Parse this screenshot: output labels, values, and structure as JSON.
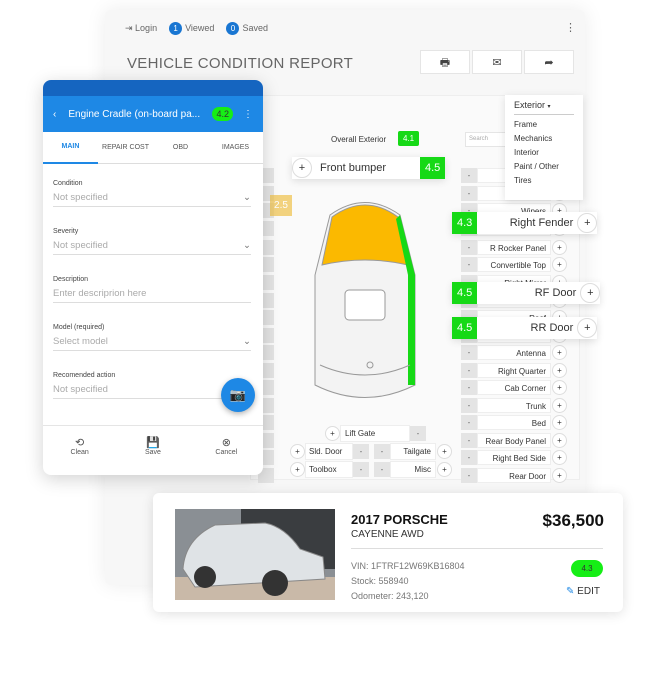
{
  "header": {
    "login": "Login",
    "viewed_count": "1",
    "viewed": "Viewed",
    "saved_count": "0",
    "saved": "Saved"
  },
  "title": "VEHICLE CONDITION REPORT",
  "toolbar": {
    "print": "🖶",
    "mail": "✉",
    "share": "➦"
  },
  "overall": {
    "label": "Overall Exterior",
    "score": "4.1"
  },
  "search_placeholder": "Search",
  "dropdown": {
    "selected": "Exterior",
    "options": [
      "Frame",
      "Mechanics",
      "Interior",
      "Paint / Other",
      "Tires"
    ]
  },
  "right_parts": [
    "",
    "Marker",
    "Wipers",
    "Right Fender",
    "R Rocker Panel",
    "Convertible Top",
    "Right Mirror",
    "RF Door",
    "Roof",
    "RR Door",
    "Antenna",
    "Right Quarter",
    "Cab Corner",
    "Trunk",
    "Bed",
    "Rear Body Panel",
    "Right Bed Side",
    "Rear Door"
  ],
  "floats": {
    "front_bumper": {
      "label": "Front bumper",
      "score": "4.5"
    },
    "right_fender": {
      "label": "Right Fender",
      "score": "4.3"
    },
    "rf_door": {
      "label": "RF Door",
      "score": "4.5"
    },
    "rr_door": {
      "label": "RR Door",
      "score": "4.5"
    },
    "left_score": "2.5"
  },
  "bottom_parts": {
    "lift_gate": "Lift Gate",
    "sld_door": "Sld. Door",
    "tailgate": "Tailgate",
    "toolbox": "Toolbox",
    "misc": "Misc"
  },
  "colors": {
    "good": "#16d916",
    "warn": "#fbb900",
    "primary": "#1e88e5"
  },
  "phone": {
    "title": "Engine Cradle (on-board pa...",
    "score": "4.2",
    "tabs": [
      "MAIN",
      "REPAIR COST",
      "OBD",
      "IMAGES"
    ],
    "fields": [
      {
        "label": "Condition",
        "value": "Not specified"
      },
      {
        "label": "Severity",
        "value": "Not specified"
      },
      {
        "label": "Description",
        "value": "Enter descriprion here"
      },
      {
        "label": "Model (required)",
        "value": "Select model"
      },
      {
        "label": "Recomended action",
        "value": "Not specified"
      }
    ],
    "actions": [
      "Clean",
      "Save",
      "Cancel"
    ]
  },
  "vehicle": {
    "title": "2017 PORSCHE",
    "subtitle": "CAYENNE AWD",
    "price": "$36,500",
    "vin": "VIN: 1FTRF12W69KB16804",
    "stock": "Stock: 558940",
    "odometer": "Odometer: 243,120",
    "score": "4.3",
    "edit": "EDIT"
  }
}
